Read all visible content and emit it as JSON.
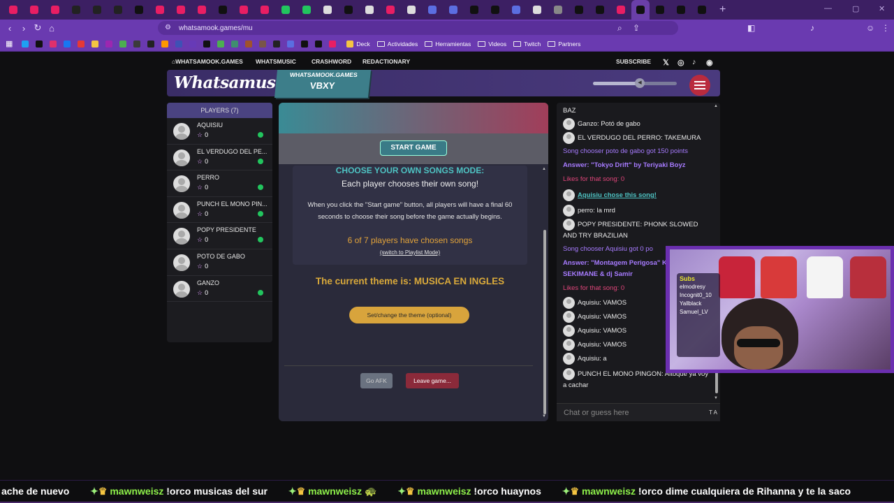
{
  "browser": {
    "url": "whatsamook.games/mu",
    "bookmarks": [
      {
        "label": "Deck"
      },
      {
        "label": "Actividades"
      },
      {
        "label": "Herramientas"
      },
      {
        "label": "Videos"
      },
      {
        "label": "Twitch"
      },
      {
        "label": "Partners"
      }
    ],
    "tab_favicon_colors": [
      "#e91e63",
      "#e91e63",
      "#e91e63",
      "#222",
      "#222",
      "#222",
      "#111",
      "#e91e63",
      "#e91e63",
      "#e91e63",
      "#111",
      "#e91e63",
      "#e91e63",
      "#22c55e",
      "#22c55e",
      "#ddd",
      "#111",
      "#ddd",
      "#e91e63",
      "#ddd",
      "#5b6ee1",
      "#5b6ee1",
      "#111",
      "#111",
      "#5b6ee1",
      "#ddd",
      "#888",
      "#111",
      "#111",
      "#e91e63",
      "#111",
      "#111",
      "#111",
      "#111"
    ]
  },
  "site_nav": {
    "home": "WHATSAMOOK.GAMES",
    "whatsamusic": "WHATSMUSIC",
    "crashword": "CRASHWORD",
    "redactionary": "REDACTIONARY",
    "subscribe": "SUBSCRIBE"
  },
  "header": {
    "logo": "Whatsamusic",
    "site": "WHATSAMOOK.GAMES",
    "room_code": "VBXY",
    "volume": 0.55
  },
  "players": {
    "title": "PLAYERS (7)",
    "list": [
      {
        "name": "AQUISIU",
        "score": "0",
        "ready": true
      },
      {
        "name": "EL VERDUGO DEL PE...",
        "score": "0",
        "ready": true
      },
      {
        "name": "PERRO",
        "score": "0",
        "ready": true
      },
      {
        "name": "PUNCH EL MONO PIN...",
        "score": "0",
        "ready": true
      },
      {
        "name": "POPY PRESIDENTE",
        "score": "0",
        "ready": true
      },
      {
        "name": "POTO DE GABO",
        "score": "0",
        "ready": false
      },
      {
        "name": "GANZO",
        "score": "0",
        "ready": true
      }
    ]
  },
  "game": {
    "start_label": "START GAME",
    "mode_title": "CHOOSE YOUR OWN SONGS MODE:",
    "mode_sub": "Each player chooses their own song!",
    "mode_desc": "When you click the \"Start game\" button, all players will have a final 60 seconds to choose their song before the game actually begins.",
    "mode_count": "6 of 7 players have chosen songs",
    "mode_switch": "(switch to Playlist Mode)",
    "theme": "The current theme is: MUSICA EN INGLES",
    "theme_button": "Set/change the theme (optional)",
    "afk_label": "Go AFK",
    "leave_label": "Leave game..."
  },
  "chat": {
    "messages": [
      {
        "type": "plain",
        "text": "BAZ"
      },
      {
        "type": "user",
        "text": "Ganzo: Potó de gabo"
      },
      {
        "type": "user",
        "text": "EL VERDUGO DEL PERRO: TAKEMURA"
      },
      {
        "type": "sys",
        "text": "Song chooser poto de gabo got 150 points"
      },
      {
        "type": "ans",
        "text": "Answer: \"Tokyo Drift\" by Teriyaki Boyz"
      },
      {
        "type": "likes",
        "text": "Likes for that song: 0"
      },
      {
        "type": "chose",
        "text": "Aquisiu chose this song!"
      },
      {
        "type": "user",
        "text": "perro: la mrd"
      },
      {
        "type": "user",
        "text": "POPY PRESIDENTE: PHONK SLOWED AND TRY BRAZILIAN"
      },
      {
        "type": "sys",
        "text": "Song chooser Aquisiu got 0 po"
      },
      {
        "type": "ans",
        "text": "Answer: \"Montagem Perigosa\" KVRXD, SEKIMANE & dj Samir"
      },
      {
        "type": "likes",
        "text": "Likes for that song: 0"
      },
      {
        "type": "user",
        "text": "Aquisiu: VAMOS"
      },
      {
        "type": "user",
        "text": "Aquisiu: VAMOS"
      },
      {
        "type": "user",
        "text": "Aquisiu: VAMOS"
      },
      {
        "type": "user",
        "text": "Aquisiu: VAMOS"
      },
      {
        "type": "user",
        "text": "Aquisiu: a"
      },
      {
        "type": "user",
        "text": "PUNCH EL MONO PINGON: Altoque ya voy a cachar"
      }
    ],
    "placeholder": "Chat or guess here",
    "format_label": "T A"
  },
  "webcam": {
    "subs_title": "Subs",
    "subs": [
      "elmodresy",
      "Incognit0_10",
      "Yallblack",
      "Samuel_LV"
    ]
  },
  "ticker": [
    {
      "text": "ache de nuevo"
    },
    {
      "name": "mawnweisz",
      "text": "!orco musicas del sur"
    },
    {
      "name": "mawnweisz",
      "text": ""
    },
    {
      "name": "mawnweisz",
      "text": "!orco huaynos"
    },
    {
      "name": "mawnweisz",
      "text": "!orco dime cualquiera de Rihanna y te la saco"
    }
  ]
}
